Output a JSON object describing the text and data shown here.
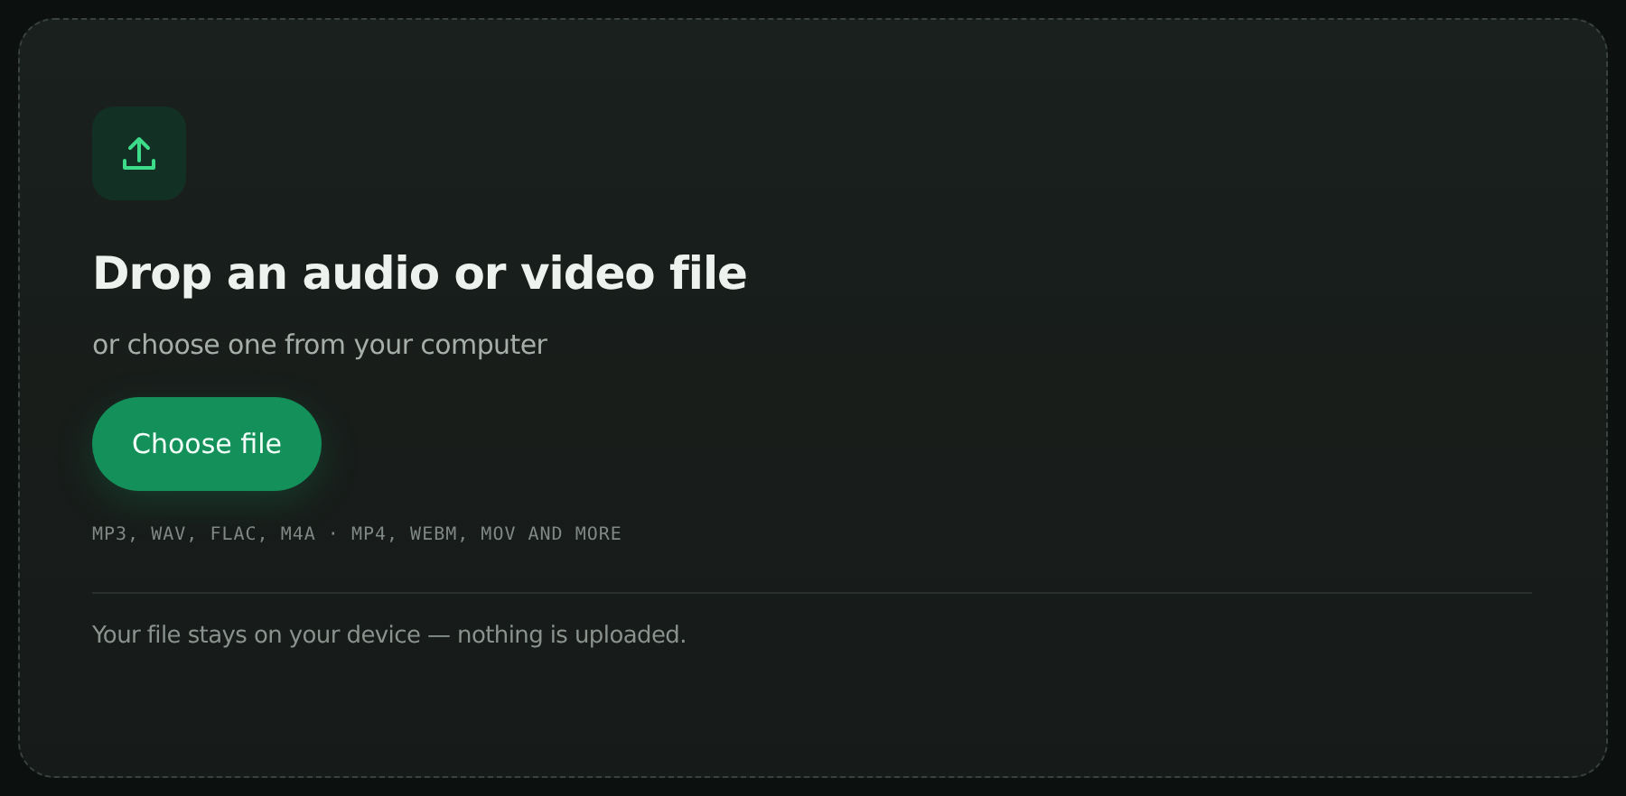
{
  "dropzone": {
    "title": "Drop an audio or video file",
    "subtitle": "or choose one from your computer",
    "button": "Choose file",
    "formats": "MP3, WAV, FLAC, M4A · MP4, WEBM, MOV AND MORE",
    "note": "Your file stays on your device — nothing is uploaded."
  }
}
